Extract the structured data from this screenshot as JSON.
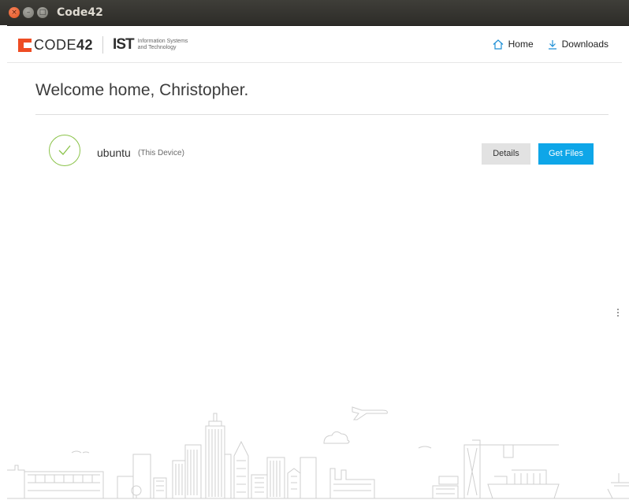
{
  "window": {
    "title": "Code42",
    "close_glyph": "×",
    "min_glyph": "–",
    "max_glyph": "□"
  },
  "header": {
    "logo_prefix": "CODE",
    "logo_suffix": "42",
    "ist_mark": "IST",
    "ist_text": "Information Systems\nand Technology",
    "nav": {
      "home_label": "Home",
      "home_icon": "home-icon",
      "downloads_label": "Downloads",
      "downloads_icon": "download-icon"
    }
  },
  "main": {
    "welcome": "Welcome home, Christopher.",
    "device": {
      "name": "ubuntu",
      "tag": "(This Device)",
      "status_icon": "check-circle-icon",
      "status_color": "#8bc34a",
      "details_label": "Details",
      "get_files_label": "Get Files"
    }
  },
  "colors": {
    "brand": "#ee4c23",
    "accent": "#0ea6e8",
    "nav_icon": "#1e8fd6"
  }
}
